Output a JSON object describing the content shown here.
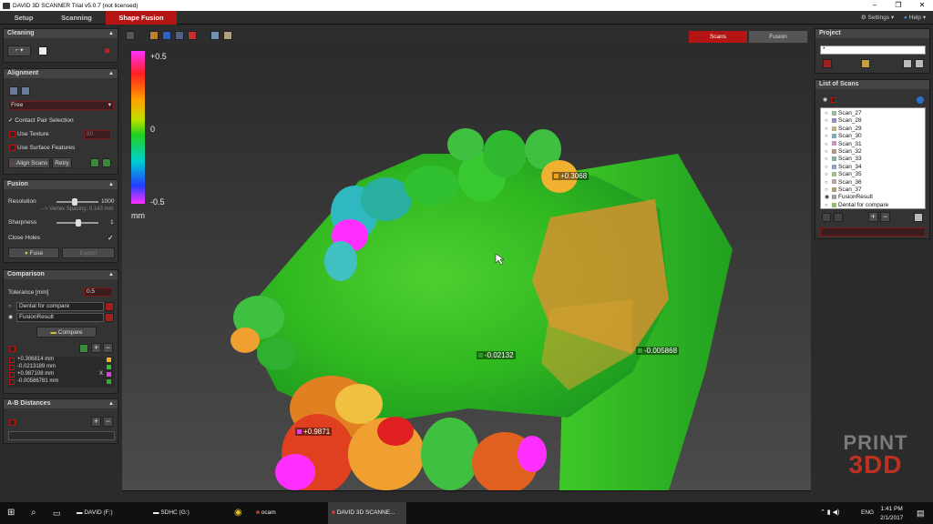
{
  "window": {
    "title": "DAVID 3D SCANNER Trial v5.0.7 (not licensed)"
  },
  "menu": {
    "setup": "Setup",
    "scanning": "Scanning",
    "shape_fusion": "Shape Fusion",
    "settings": "Settings ▾",
    "help": "Help ▾"
  },
  "cleaning": {
    "title": "Cleaning"
  },
  "alignment": {
    "title": "Alignment",
    "mode": "Free",
    "contact_pair": "Contact Pair Selection",
    "use_texture": "Use Texture",
    "texture_value": "80",
    "use_surface": "Use Surface Features",
    "align_scans": "Align Scans",
    "retry": "Retry"
  },
  "fusion": {
    "title": "Fusion",
    "resolution_label": "Resolution",
    "resolution_value": "1000",
    "vertex_spacing": "--> Vertex Spacing: 0.143 mm",
    "sharpness_label": "Sharpness",
    "sharpness_value": "1",
    "close_holes": "Close Holes",
    "fuse": "Fuse",
    "export": "Export"
  },
  "comparison": {
    "title": "Comparison",
    "tolerance_label": "Tolerance [mm]",
    "tolerance_value": "0.5",
    "item1": "Dental for compare",
    "item2": "FusionResult",
    "compare": "Compare",
    "results": [
      "+0.306814 mm",
      "-0.0213189 mm",
      "+0.987108 mm",
      "-0.00586781 mm"
    ],
    "result_x": "X"
  },
  "ab_distances": {
    "title": "A-B Distances"
  },
  "viewport": {
    "tab_scans": "Scans",
    "tab_fusion": "Fusion"
  },
  "colorbar": {
    "max": "+0.5",
    "mid": "0",
    "min": "-0.5",
    "unit": "mm"
  },
  "markers": [
    {
      "text": "+0.3068",
      "color": "#f0a020"
    },
    {
      "text": "-0.02132",
      "color": "#20a020"
    },
    {
      "text": "-0.005868",
      "color": "#30a030"
    },
    {
      "text": "+0.9871",
      "color": "#e040e0"
    }
  ],
  "project": {
    "title": "Project",
    "name": "*"
  },
  "scans": {
    "title": "List of Scans",
    "items": [
      {
        "name": "Scan_27",
        "color": "#8fc08f"
      },
      {
        "name": "Scan_28",
        "color": "#8f8fd0"
      },
      {
        "name": "Scan_29",
        "color": "#c0b080"
      },
      {
        "name": "Scan_30",
        "color": "#70b0c0"
      },
      {
        "name": "Scan_31",
        "color": "#d090c0"
      },
      {
        "name": "Scan_32",
        "color": "#c09080"
      },
      {
        "name": "Scan_33",
        "color": "#80b0a0"
      },
      {
        "name": "Scan_34",
        "color": "#90a0d0"
      },
      {
        "name": "Scan_35",
        "color": "#a0c080"
      },
      {
        "name": "Scan_36",
        "color": "#c0a0a0"
      },
      {
        "name": "Scan_37",
        "color": "#b0a070"
      },
      {
        "name": "FusionResult",
        "color": "#a0a0a0"
      },
      {
        "name": "Dental for compare",
        "color": "#90c060"
      }
    ]
  },
  "watermark": {
    "line1": "PRINT",
    "line2": "3DD"
  },
  "taskbar": {
    "david": "DAVID (F:)",
    "sdhc": "SDHC (G:)",
    "ocam": "ocam",
    "scanner": "DAVID 3D SCANNE...",
    "lang": "ENG",
    "time": "1:41 PM",
    "date": "2/1/2017"
  }
}
